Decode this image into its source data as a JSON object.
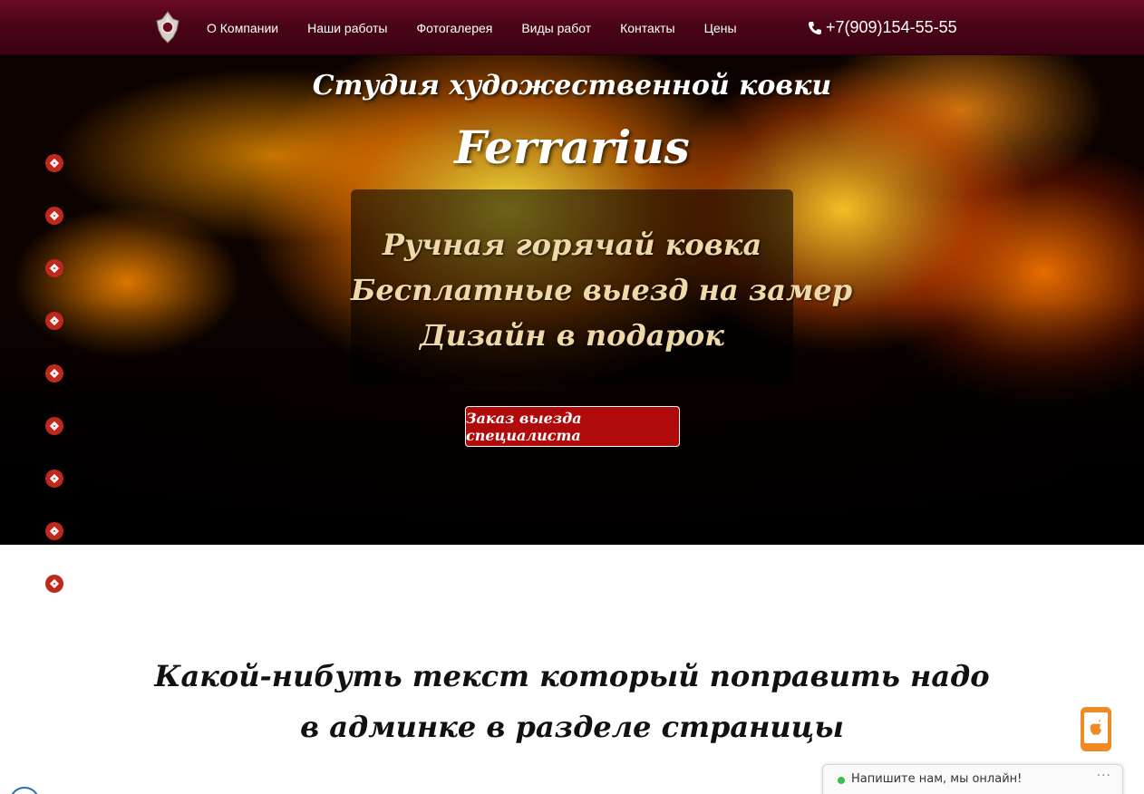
{
  "nav": {
    "items": [
      {
        "label": "О Компании"
      },
      {
        "label": "Наши работы"
      },
      {
        "label": "Фотогалерея"
      },
      {
        "label": "Виды работ"
      },
      {
        "label": "Контакты"
      },
      {
        "label": "Цены"
      }
    ],
    "phone": "+7(909)154-55-55"
  },
  "hero": {
    "title": "Студия художественной ковки",
    "brand": "Ferrarius",
    "lines": [
      "Ручная горячай ковка",
      "Бесплатные выезд на замер",
      "Дизайн в подарок"
    ],
    "cta_label": "Заказ выезда специалиста"
  },
  "content": {
    "text": "Какой-нибуть текст который поправить надо в админке в разделе страницы"
  },
  "chat": {
    "text": "Напишите нам, мы онлайн!",
    "more": "···"
  },
  "colors": {
    "nav_bg": "#4a0517",
    "accent_red": "#b00a0a",
    "dot_red": "#c0281e",
    "widget_orange": "#f08a24",
    "online_green": "#3cc04a"
  }
}
